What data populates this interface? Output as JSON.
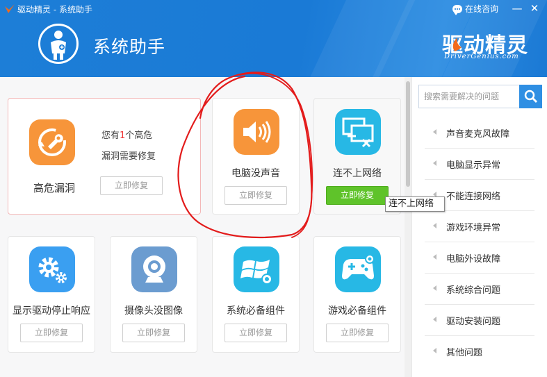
{
  "window": {
    "title": "驱动精灵 - 系统助手",
    "consult_label": "在线咨询",
    "minimize": "—",
    "close": "✕"
  },
  "header": {
    "page_title": "系统助手",
    "brand_cn": "驱动精灵",
    "brand_en": "DriverGenius.com"
  },
  "colors": {
    "header_blue": "#1d7ed7",
    "orange_icon": "#f7953a",
    "blue_icon": "#3a9ff1",
    "cyan_icon": "#27b8e5",
    "green_button": "#5fc32a",
    "annotation_red": "#e31b1b"
  },
  "cards": {
    "high_risk": {
      "title": "高危漏洞",
      "line1_prefix": "您有",
      "line1_count": "1",
      "line1_suffix": "个高危",
      "line2": "漏洞需要修复",
      "button": "立即修复",
      "icon": "wrench-refresh-icon"
    },
    "no_sound": {
      "title": "电脑没声音",
      "button": "立即修复",
      "icon": "speaker-icon"
    },
    "no_network": {
      "title": "连不上网络",
      "button": "立即修复",
      "icon": "network-disconnected-icon"
    },
    "display_driver": {
      "title": "显示驱动停止响应",
      "button": "立即修复",
      "icon": "gear-icon"
    },
    "camera": {
      "title": "摄像头没图像",
      "button": "立即修复",
      "icon": "webcam-icon"
    },
    "system_components": {
      "title": "系统必备组件",
      "button": "立即修复",
      "icon": "windows-gear-icon"
    },
    "game_components": {
      "title": "游戏必备组件",
      "button": "立即修复",
      "icon": "gamepad-icon"
    }
  },
  "tooltip": "连不上网络",
  "sidebar": {
    "search_placeholder": "搜索需要解决的问题",
    "items": [
      {
        "label": "声音麦克风故障"
      },
      {
        "label": "电脑显示异常"
      },
      {
        "label": "不能连接网络"
      },
      {
        "label": "游戏环境异常"
      },
      {
        "label": "电脑外设故障"
      },
      {
        "label": "系统综合问题"
      },
      {
        "label": "驱动安装问题"
      },
      {
        "label": "其他问题"
      }
    ]
  }
}
